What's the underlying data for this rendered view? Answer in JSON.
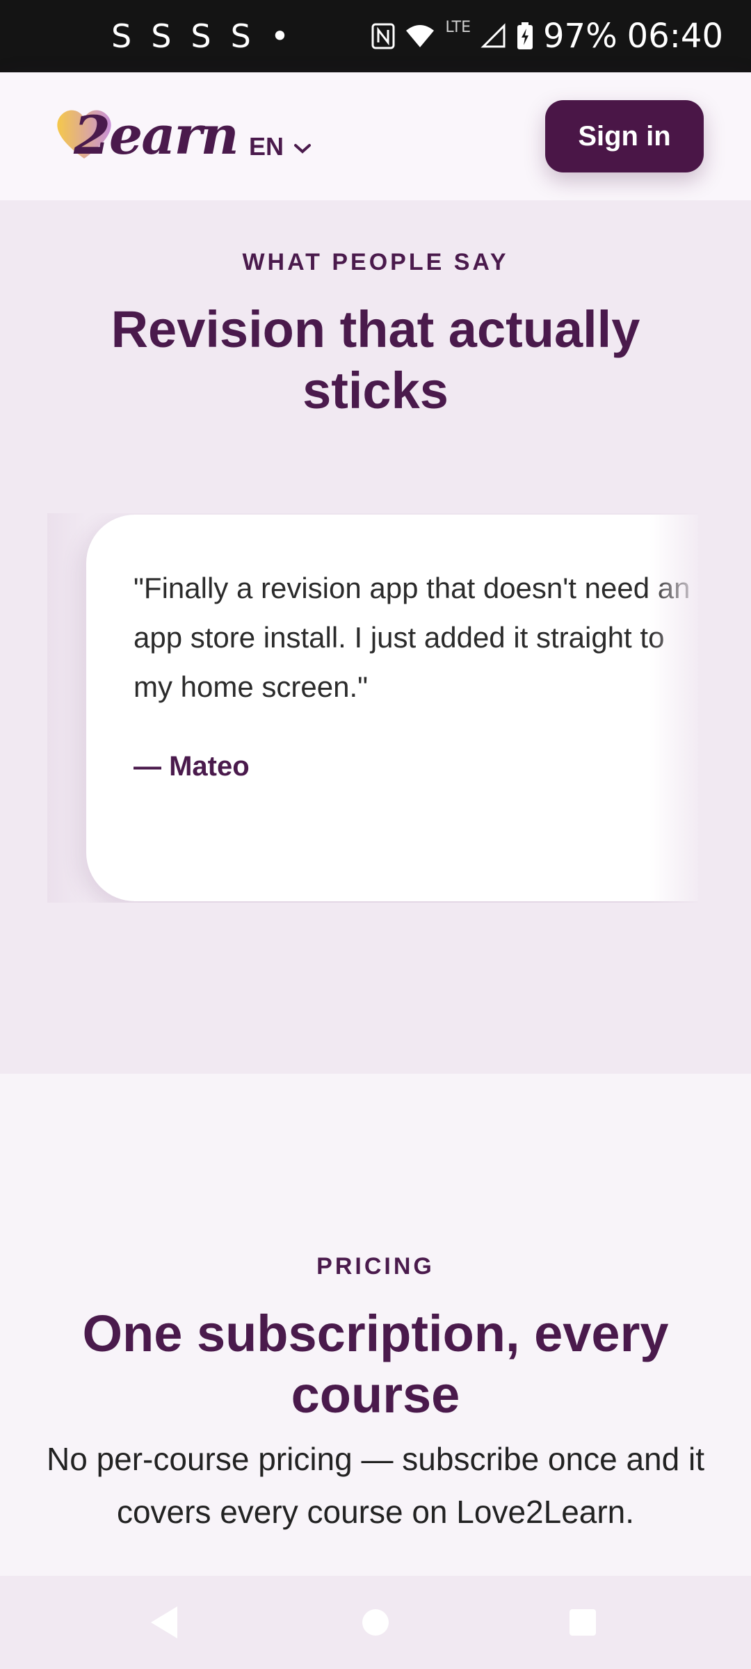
{
  "status_bar": {
    "left_icons": [
      "S",
      "S",
      "S",
      "S",
      "•"
    ],
    "lte_label": "LTE",
    "battery": "97%",
    "time": "06:40"
  },
  "header": {
    "logo_text": "2earn",
    "language": "EN",
    "sign_in_label": "Sign in"
  },
  "testimonials": {
    "eyebrow": "WHAT PEOPLE SAY",
    "title": "Revision that actually sticks",
    "card": {
      "quote": "\"Finally a revision app that doesn't need an app store install. I just added it straight to my home screen.\"",
      "author": "— Mateo"
    }
  },
  "pricing": {
    "eyebrow": "PRICING",
    "title": "One subscription, every course",
    "description": "No per-course pricing — subscribe once and it covers every course on Love2Learn."
  },
  "colors": {
    "brand": "#4a1647",
    "heading": "#4a1a4c",
    "section_bg": "#f1e9f2",
    "pricing_bg": "#f8f4f9",
    "logo_gradient_start": "#f5c84a",
    "logo_gradient_end": "#c890d8"
  },
  "icons": {
    "nfc": "nfc-icon",
    "wifi": "wifi-icon",
    "signal": "signal-icon",
    "battery": "battery-charging-icon",
    "language_chevron": "chevron-down-icon",
    "nav_back": "back-triangle-icon",
    "nav_home": "home-circle-icon",
    "nav_recents": "recents-square-icon"
  }
}
